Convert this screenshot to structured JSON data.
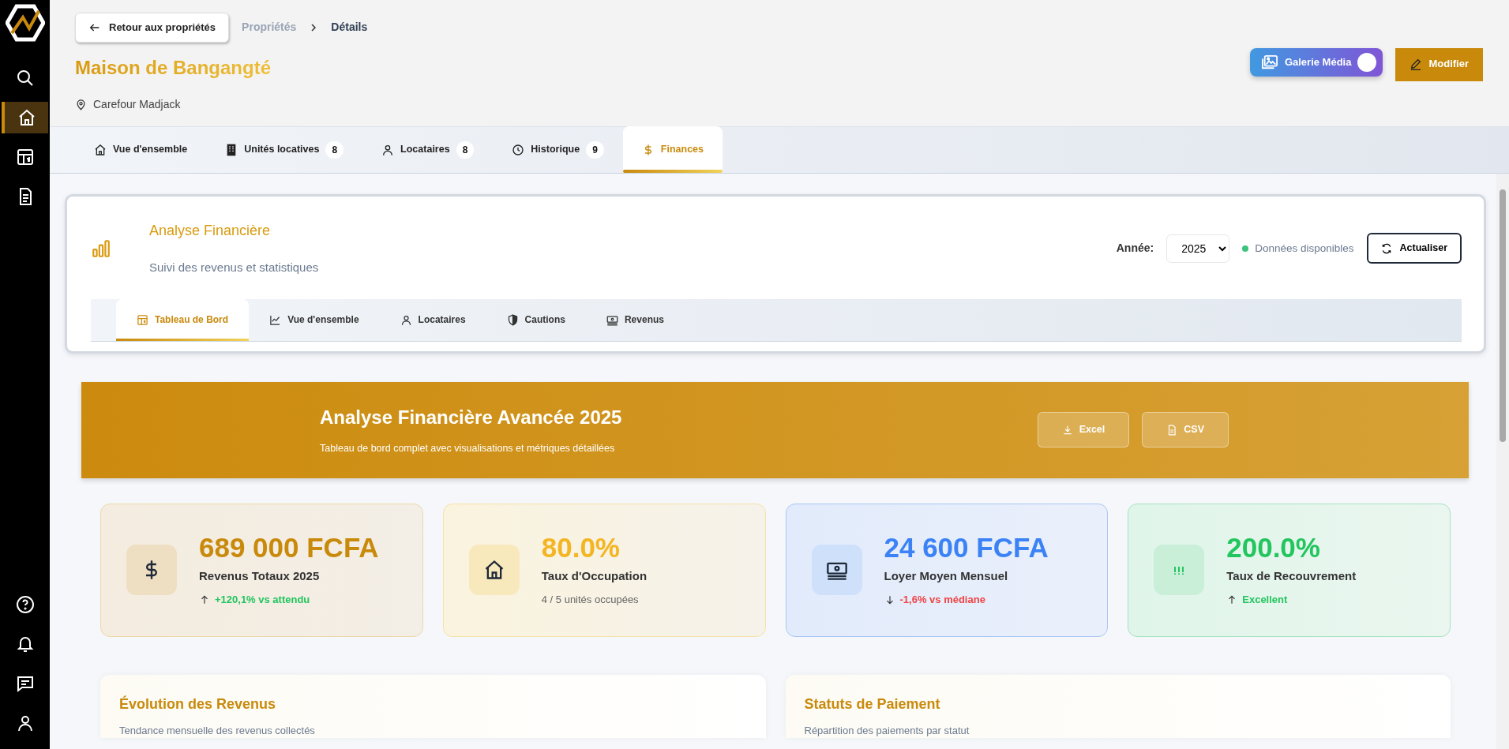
{
  "sidebar": {
    "top_items": [
      {
        "selected": false
      },
      {
        "selected": true
      },
      {
        "selected": false
      },
      {
        "selected": false
      }
    ],
    "bottom_items": [
      {
        "selected": false
      },
      {
        "selected": false
      },
      {
        "selected": false
      },
      {
        "selected": false
      }
    ]
  },
  "header": {
    "back_button": "Retour aux propriétés",
    "breadcrumb": [
      "Propriétés",
      "Détails"
    ],
    "title": "Maison de Bangangté",
    "location": "Carefour Madjack",
    "gallery_button": "Galerie Média",
    "edit_button": "Modifier"
  },
  "property_tabs": [
    {
      "label": "Vue d'ensemble",
      "selected": false
    },
    {
      "label": "Unités locatives",
      "count": "8",
      "selected": false
    },
    {
      "label": "Locataires",
      "count": "8",
      "selected": false
    },
    {
      "label": "Historique",
      "count": "9",
      "selected": false
    },
    {
      "label": "Finances",
      "selected": true
    }
  ],
  "finance": {
    "title": "Analyse Financière",
    "subtitle": "Suivi des revenus et statistiques",
    "year_label": "Année:",
    "year": "2025",
    "status": "Données disponibles",
    "refresh_button": "Actualiser",
    "tabs": [
      {
        "label": "Tableau de Bord",
        "selected": true
      },
      {
        "label": "Vue d'ensemble",
        "selected": false
      },
      {
        "label": "Locataires",
        "selected": false
      },
      {
        "label": "Cautions",
        "selected": false
      },
      {
        "label": "Revenus",
        "selected": false
      }
    ]
  },
  "banner": {
    "title": "Analyse Financière Avancée 2025",
    "subtitle": "Tableau de bord complet avec visualisations et métriques détaillées",
    "buttons": [
      "Excel",
      "CSV"
    ]
  },
  "stats": [
    {
      "value": "689 000 FCFA",
      "label": "Revenus Totaux 2025",
      "note": "+120,1% vs attendu",
      "kind": "up",
      "color": "#c98a0c"
    },
    {
      "value": "80.0%",
      "label": "Taux d'Occupation",
      "note": "4 / 5 unités occupées",
      "kind": "plain",
      "color": "#f4b522"
    },
    {
      "value": "24 600 FCFA",
      "label": "Loyer Moyen Mensuel",
      "note": "-1,6% vs médiane",
      "kind": "down",
      "color": "#3b82f6"
    },
    {
      "value": "200.0%",
      "label": "Taux de Recouvrement",
      "note": "Excellent",
      "kind": "up",
      "color": "#22c55e"
    }
  ],
  "panels": [
    {
      "title": "Évolution des Revenus",
      "subtitle": "Tendance mensuelle des revenus collectés"
    },
    {
      "title": "Statuts de Paiement",
      "subtitle": "Répartition des paiements par statut"
    }
  ]
}
